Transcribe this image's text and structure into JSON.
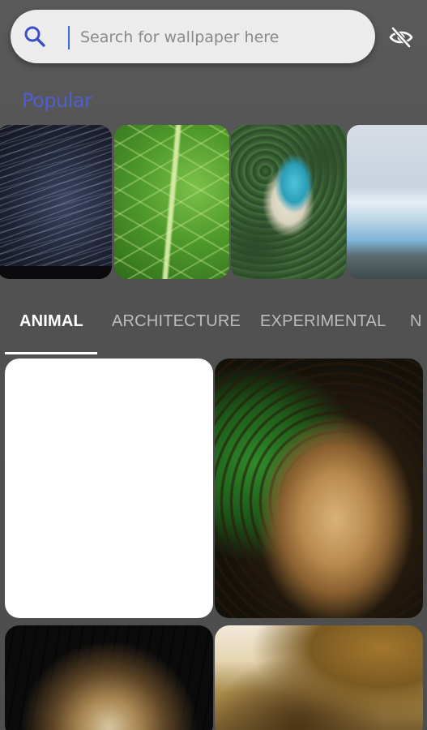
{
  "search": {
    "placeholder": "Search for wallpaper here"
  },
  "icons": {
    "search": "search-icon",
    "visibility_off": "visibility-off-icon"
  },
  "colors": {
    "accent": "#4f5fd0",
    "search_icon": "#3b4fc8",
    "background": "#545454"
  },
  "popular": {
    "label": "Popular",
    "items": [
      {
        "name": "star-trails"
      },
      {
        "name": "green-leaf"
      },
      {
        "name": "tropical-island"
      },
      {
        "name": "glacier"
      }
    ]
  },
  "tabs": [
    {
      "label": "ANIMAL",
      "active": true
    },
    {
      "label": "ARCHITECTURE",
      "active": false
    },
    {
      "label": "EXPERIMENTAL",
      "active": false
    },
    {
      "label": "N",
      "active": false
    }
  ],
  "grid": [
    {
      "name": "blank-wallpaper"
    },
    {
      "name": "leopard-wallpaper"
    },
    {
      "name": "tiger-wallpaper"
    },
    {
      "name": "deer-wallpaper"
    }
  ]
}
